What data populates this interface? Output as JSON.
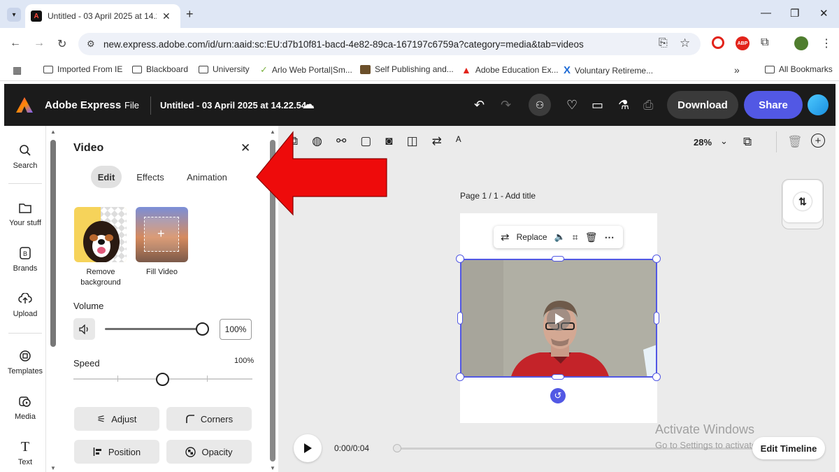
{
  "browser": {
    "tab_title": "Untitled - 03 April 2025 at 14.22.54",
    "url": "new.express.adobe.com/id/urn:aaid:sc:EU:d7b10f81-bacd-4e82-89ca-167197c6759a?category=media&tab=videos",
    "bookmarks": [
      "Imported From IE",
      "Blackboard",
      "University",
      "Arlo Web Portal|Sm...",
      "Self Publishing and...",
      "Adobe Education Ex...",
      "Voluntary Retireme..."
    ],
    "bookmarks_more": "»",
    "all_bookmarks": "All Bookmarks"
  },
  "app": {
    "brand": "Adobe Express",
    "file_menu": "File",
    "doc_title": "Untitled - 03 April 2025 at 14.22.54",
    "download_label": "Download",
    "share_label": "Share",
    "accent": "#5258e4"
  },
  "rail": {
    "items": [
      {
        "label": "Search",
        "icon": "search-icon"
      },
      {
        "label": "Your stuff",
        "icon": "folder-icon"
      },
      {
        "label": "Brands",
        "icon": "brand-icon"
      },
      {
        "label": "Upload",
        "icon": "upload-icon"
      },
      {
        "label": "Templates",
        "icon": "templates-icon"
      },
      {
        "label": "Media",
        "icon": "media-icon"
      },
      {
        "label": "Text",
        "icon": "text-icon"
      }
    ]
  },
  "panel": {
    "title": "Video",
    "tabs": [
      "Edit",
      "Effects",
      "Animation"
    ],
    "active_tab": "Edit",
    "cards": [
      {
        "label_line1": "Remove",
        "label_line2": "background"
      },
      {
        "label_line1": "Fill Video",
        "label_line2": ""
      }
    ],
    "volume_label": "Volume",
    "volume_value": "100%",
    "volume_level": 1.0,
    "speed_label": "Speed",
    "speed_value": "100%",
    "speed_level": 0.5,
    "buttons": [
      "Adjust",
      "Corners",
      "Position",
      "Opacity"
    ]
  },
  "canvas": {
    "zoom": "28%",
    "page_label": "Page 1 / 1 - Add title",
    "context_replace": "Replace",
    "time": "0:00/0:04",
    "edit_timeline": "Edit Timeline",
    "watermark_title": "Activate Windows",
    "watermark_sub": "Go to Settings to activate Windows."
  }
}
